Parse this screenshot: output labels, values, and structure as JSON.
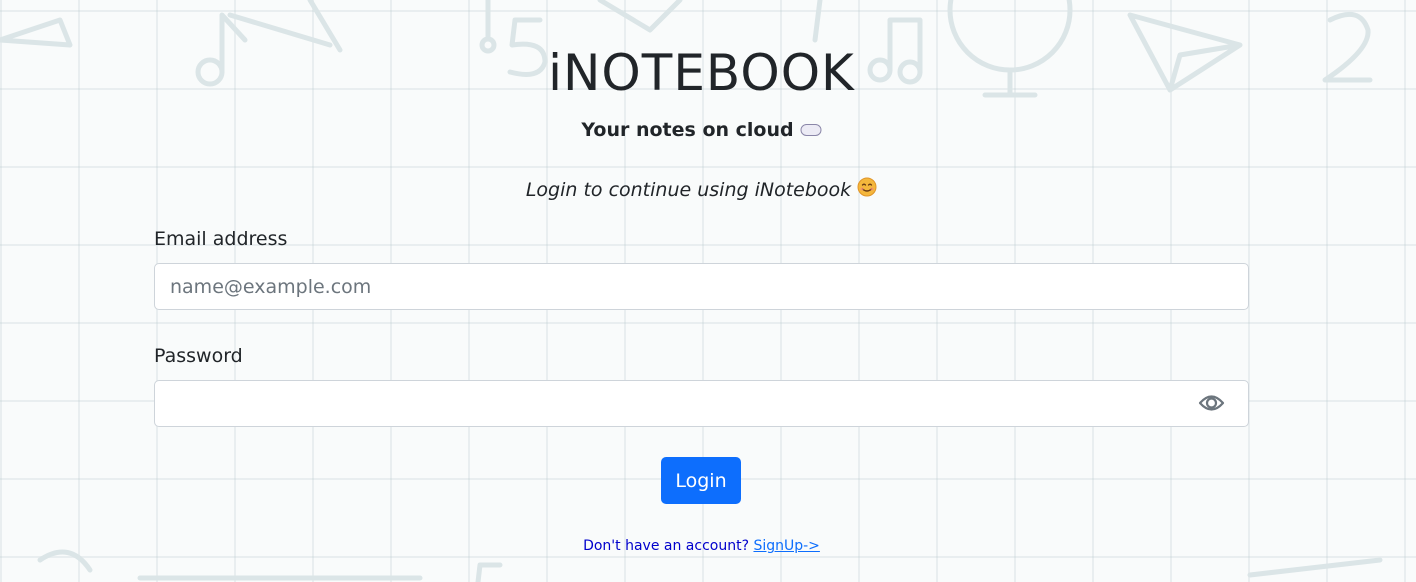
{
  "brand": {
    "title": "iNOTEBOOK",
    "tagline": "Your notes on cloud",
    "tagline_icon": "cloud-icon"
  },
  "intro": {
    "text": "Login to continue using iNotebook",
    "icon": "smiling-face-icon"
  },
  "form": {
    "email": {
      "label": "Email address",
      "value": "",
      "placeholder": "name@example.com"
    },
    "password": {
      "label": "Password",
      "value": "",
      "placeholder": "",
      "toggle_icon": "eye-icon"
    },
    "login_label": "Login"
  },
  "footer": {
    "prompt": "Don't have an account?",
    "signup_label": "SignUp->"
  },
  "colors": {
    "primary": "#0d6efd",
    "text": "#212529",
    "prompt_text": "#0000cc",
    "input_border": "#ced4da",
    "background": "#f9fbfb"
  }
}
